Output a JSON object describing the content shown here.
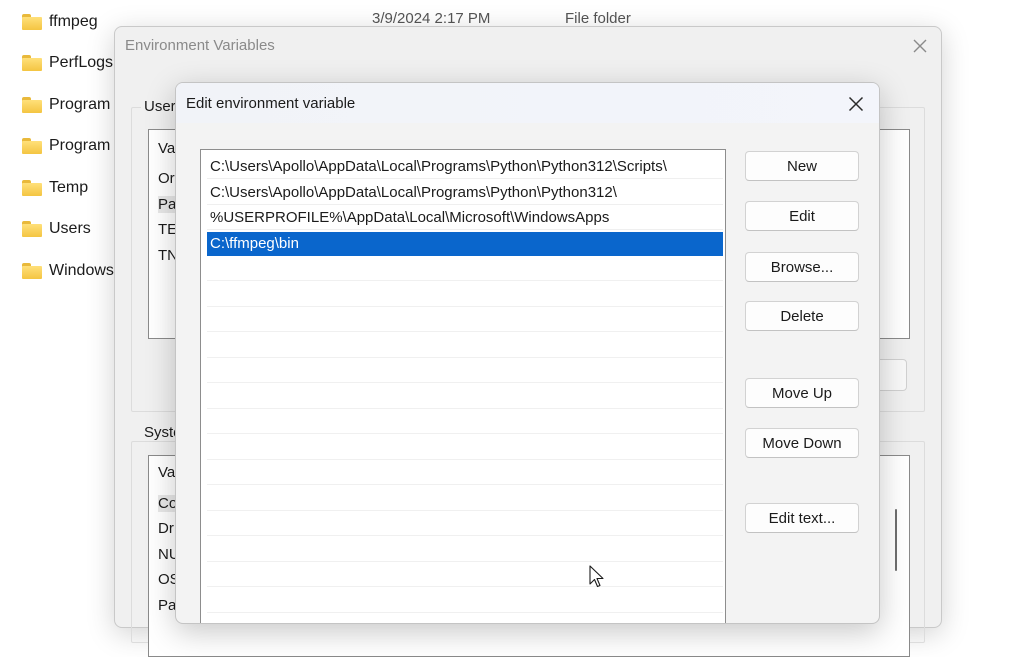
{
  "explorer": {
    "folders": [
      {
        "name": "ffmpeg"
      },
      {
        "name": "PerfLogs"
      },
      {
        "name": "Program"
      },
      {
        "name": "Program"
      },
      {
        "name": "Temp"
      },
      {
        "name": "Users"
      },
      {
        "name": "Windows"
      }
    ],
    "first_row_date": "3/9/2024 2:17 PM",
    "first_row_type": "File folder"
  },
  "env_dialog": {
    "title": "Environment Variables",
    "user_group_label": "User",
    "user_list_header": "Va",
    "user_vars": [
      "Or",
      "Pa",
      "TE",
      "TN"
    ],
    "system_group_label": "Syste",
    "system_list_header": "Va",
    "system_vars": [
      "Co",
      "Dr",
      "NU",
      "OS",
      "Pa"
    ]
  },
  "edit_dialog": {
    "title": "Edit environment variable",
    "paths": [
      "C:\\Users\\Apollo\\AppData\\Local\\Programs\\Python\\Python312\\Scripts\\",
      "C:\\Users\\Apollo\\AppData\\Local\\Programs\\Python\\Python312\\",
      "%USERPROFILE%\\AppData\\Local\\Microsoft\\WindowsApps",
      "C:\\ffmpeg\\bin"
    ],
    "selected_index": 3,
    "buttons": {
      "new": "New",
      "edit": "Edit",
      "browse": "Browse...",
      "delete": "Delete",
      "move_up": "Move Up",
      "move_down": "Move Down",
      "edit_text": "Edit text..."
    }
  },
  "colors": {
    "selection": "#0a66cc",
    "folder": "#f4c542"
  }
}
